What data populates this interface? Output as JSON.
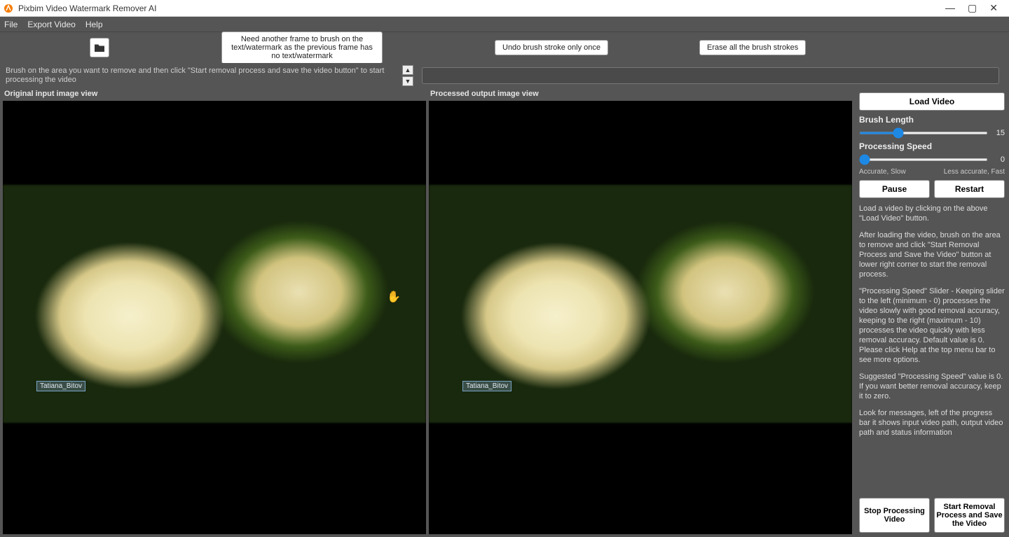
{
  "titlebar": {
    "app_title": "Pixbim Video Watermark Remover AI"
  },
  "menu": {
    "file": "File",
    "export": "Export Video",
    "help": "Help"
  },
  "toolbar": {
    "need_frame": "Need another frame to brush on the text/watermark as the previous frame has no text/watermark",
    "undo": "Undo brush stroke only once",
    "erase": "Erase all the brush strokes"
  },
  "instruction": {
    "text": "Brush on the area you want to remove and then click \"Start removal process and save the video button\" to start processing the video"
  },
  "views": {
    "original_label": "Original input image view",
    "processed_label": "Processed output image view",
    "watermark_text": "Tatiana_Bitov"
  },
  "sidebar": {
    "load_video": "Load Video",
    "brush_length_label": "Brush Length",
    "brush_length_value": "15",
    "processing_speed_label": "Processing Speed",
    "processing_speed_value": "0",
    "accurate_slow": "Accurate, Slow",
    "less_accurate_fast": "Less accurate, Fast",
    "pause": "Pause",
    "restart": "Restart",
    "info_1": "Load a video by clicking on the above \"Load Video\" button.",
    "info_2": "After loading the video, brush on the area to remove and click \"Start Removal Process and Save the Video\" button at lower right corner to start the removal process.",
    "info_3": "\"Processing Speed\" Slider - Keeping slider to the left (minimum - 0) processes the video slowly with good removal accuracy, keeping to the right (maximum - 10) processes the video quickly with less removal accuracy. Default value is 0. Please click Help at the top menu bar to see more options.",
    "info_4": "Suggested \"Processing Speed\" value is 0. If you want better removal accuracy, keep it to zero.",
    "info_5": "Look for messages, left of the progress bar it shows input video path, output video path and status information",
    "stop_processing": "Stop Processing Video",
    "start_removal": "Start Removal Process and Save the Video"
  }
}
